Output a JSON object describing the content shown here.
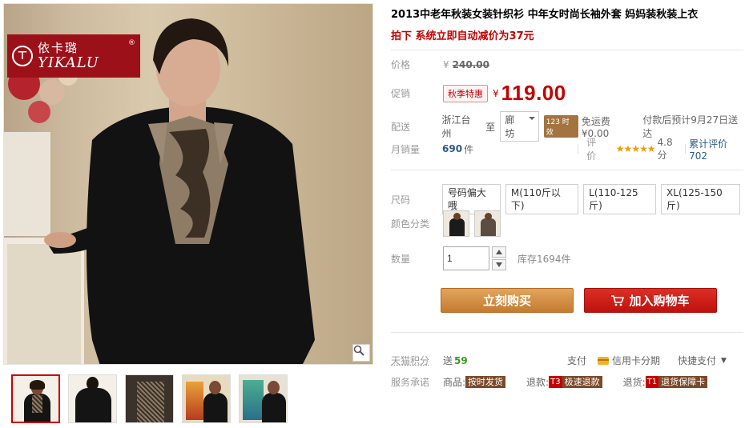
{
  "brand": {
    "name_cn": "依卡璐",
    "name_en": "YIKALU",
    "reg": "®"
  },
  "product": {
    "title": "2013中老年秋装女装针织衫 中年女时尚长袖外套 妈妈装秋装上衣",
    "promo_line": "拍下 系统立即自动减价为37元"
  },
  "price": {
    "label": "价格",
    "currency": "¥",
    "original": "240.00"
  },
  "promotion": {
    "label": "促销",
    "tag": "秋季特惠",
    "currency": "¥",
    "value": "119.00"
  },
  "shipping": {
    "label": "配送",
    "from": "浙江台州",
    "to_word": "至",
    "destination": "廊坊",
    "badge": "123 时效",
    "fee": "免运费 ¥0.00",
    "eta": "付款后预计9月27日送达"
  },
  "sales": {
    "label": "月销量",
    "count": "690",
    "unit": "件",
    "rating_label": "评价",
    "stars": "★★★★★",
    "score": "4.8分",
    "review_link": "累计评价702"
  },
  "size": {
    "label": "尺码",
    "options": [
      "号码偏大哦",
      "M(110斤以下)",
      "L(110-125斤)",
      "XL(125-150斤)"
    ]
  },
  "color": {
    "label": "颜色分类"
  },
  "quantity": {
    "label": "数量",
    "value": "1",
    "stock": "库存1694件"
  },
  "actions": {
    "buy": "立刻购买",
    "cart": "加入购物车"
  },
  "points": {
    "label": "天猫积分",
    "prefix": "送",
    "value": "59"
  },
  "payment": {
    "label": "支付",
    "credit": "信用卡分期",
    "quick": "快捷支付"
  },
  "service": {
    "label": "服务承诺",
    "goods_label": "商品:",
    "goods_tag": "按时发货",
    "refund_label": "退款:",
    "refund_code": "T3",
    "refund_tag": "极速退款",
    "return_label": "退货:",
    "return_code": "T1",
    "return_tag": "退货保障卡"
  },
  "colors": {
    "price_red": "#c40000",
    "buy_orange": "#c47b2f",
    "cart_red": "#bf120e",
    "brand_red": "#9c1119"
  },
  "icons": [
    "zoom-icon",
    "cart-icon",
    "card-icon",
    "chevron-down-icon",
    "caret-down-icon",
    "up-arrow-icon",
    "down-arrow-icon"
  ]
}
